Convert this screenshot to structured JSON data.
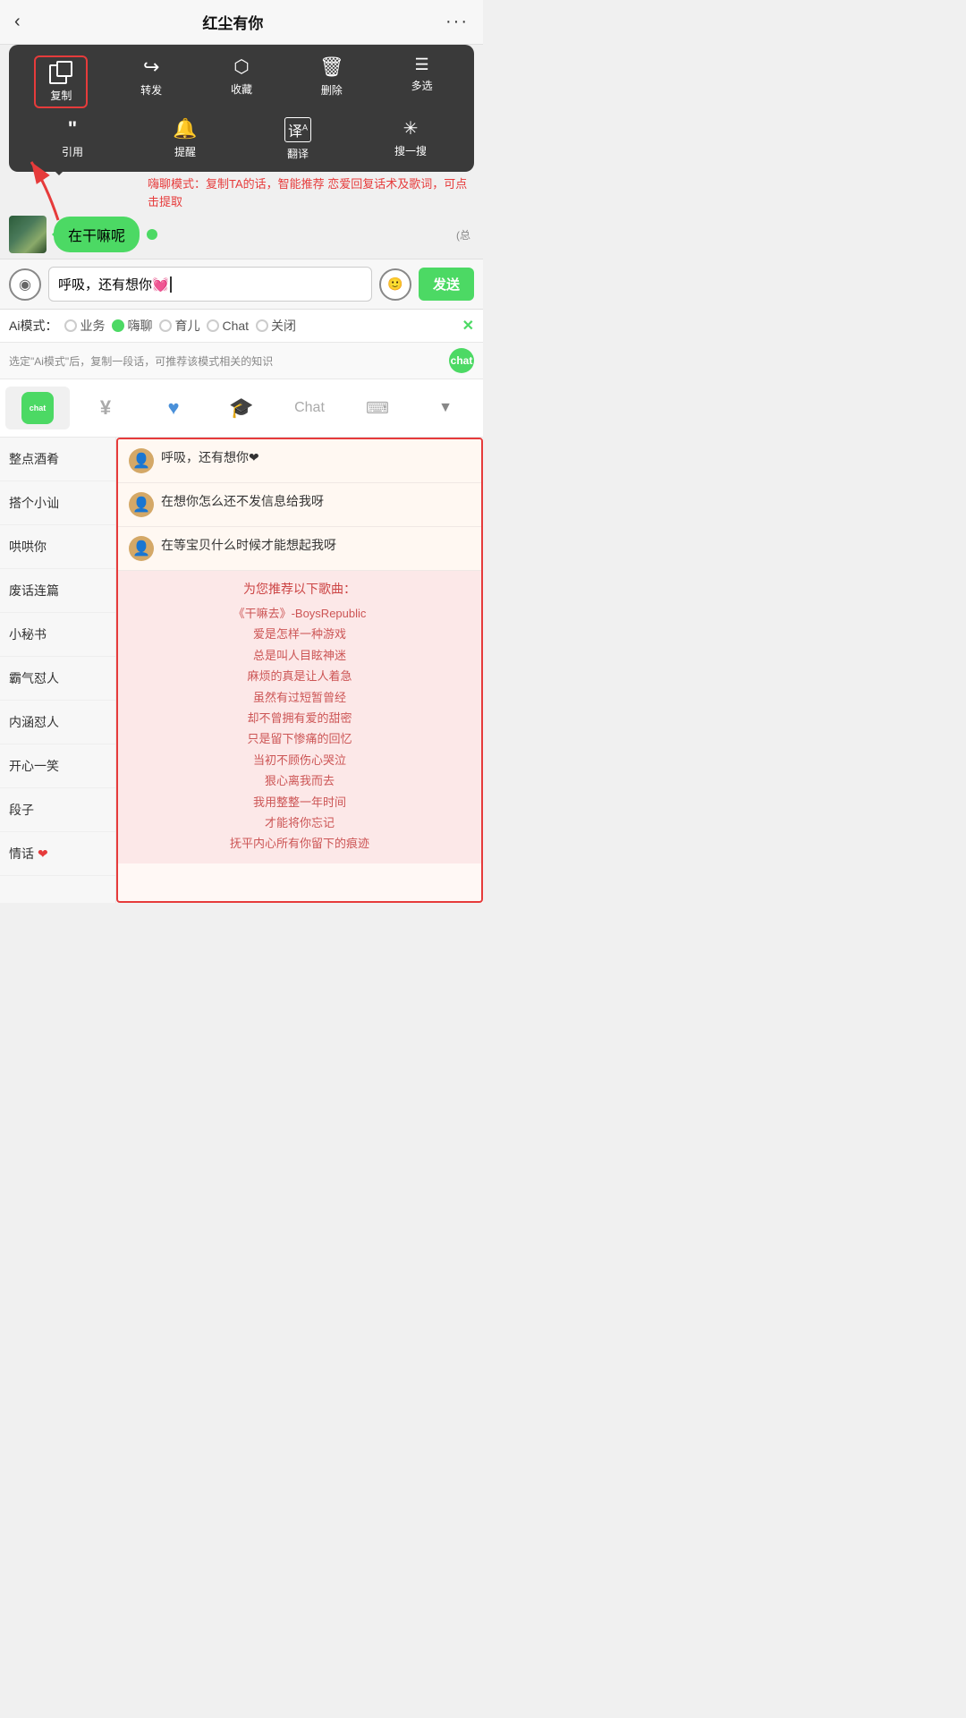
{
  "header": {
    "title": "红尘有你",
    "back_label": "‹",
    "more_label": "···"
  },
  "context_menu": {
    "row1": [
      {
        "id": "copy",
        "icon": "copy",
        "label": "复制",
        "selected": true
      },
      {
        "id": "forward",
        "icon": "↪",
        "label": "转发",
        "selected": false
      },
      {
        "id": "collect",
        "icon": "🎁",
        "label": "收藏",
        "selected": false
      },
      {
        "id": "delete",
        "icon": "🗑",
        "label": "删除",
        "selected": false
      },
      {
        "id": "multiselect",
        "icon": "☰",
        "label": "多选",
        "selected": false
      }
    ],
    "row2": [
      {
        "id": "quote",
        "icon": "❝",
        "label": "引用",
        "selected": false
      },
      {
        "id": "remind",
        "icon": "🔔",
        "label": "提醒",
        "selected": false
      },
      {
        "id": "translate",
        "icon": "译",
        "label": "翻译",
        "selected": false
      },
      {
        "id": "search",
        "icon": "✳",
        "label": "搜一搜",
        "selected": false
      }
    ]
  },
  "annotation": {
    "text": "嗨聊模式：复制TA的话，智能推荐\n恋爱回复话术及歌词，可点击提取"
  },
  "chat_bubble": {
    "message": "在干嘛呢"
  },
  "input": {
    "value": "呼吸，还有想你💓",
    "send_label": "发送"
  },
  "ai_modes": {
    "label": "Ai模式：",
    "options": [
      {
        "id": "business",
        "label": "业务",
        "selected": false
      },
      {
        "id": "haichat",
        "label": "嗨聊",
        "selected": true
      },
      {
        "id": "parenting",
        "label": "育儿",
        "selected": false
      },
      {
        "id": "chat",
        "label": "Chat",
        "selected": false
      },
      {
        "id": "close",
        "label": "关闭",
        "selected": false
      }
    ],
    "close_icon": "✕"
  },
  "hint_bar": {
    "text": "选定\"Ai模式\"后，复制一段话，可推荐该模式相关的知识"
  },
  "toolbar": {
    "items": [
      {
        "id": "chat-ai",
        "icon": "chat",
        "label": ""
      },
      {
        "id": "money",
        "icon": "¥",
        "label": ""
      },
      {
        "id": "heart",
        "icon": "♥",
        "label": ""
      },
      {
        "id": "grad",
        "icon": "🎓",
        "label": ""
      },
      {
        "id": "chat-text",
        "icon": "Chat",
        "label": ""
      },
      {
        "id": "keyboard",
        "icon": "⌨",
        "label": ""
      },
      {
        "id": "expand",
        "icon": "▼",
        "label": ""
      }
    ]
  },
  "sidebar": {
    "items": [
      {
        "id": "zhengdian",
        "label": "整点酒肴"
      },
      {
        "id": "dage",
        "label": "搭个小讪"
      },
      {
        "id": "hahaha",
        "label": "哄哄你"
      },
      {
        "id": "fehua",
        "label": "废话连篇"
      },
      {
        "id": "xiaomishu",
        "label": "小秘书"
      },
      {
        "id": "baqiren",
        "label": "霸气怼人"
      },
      {
        "id": "neihanyiren",
        "label": "内涵怼人"
      },
      {
        "id": "kaixin",
        "label": "开心一笑"
      },
      {
        "id": "duanzi",
        "label": "段子"
      },
      {
        "id": "qinghua",
        "label": "情话",
        "heart": true
      }
    ]
  },
  "suggestions": [
    {
      "text": "呼吸，还有想你❤"
    },
    {
      "text": "在想你怎么还不发信息给我呀"
    },
    {
      "text": "在等宝贝什么时候才能想起我呀"
    }
  ],
  "song_section": {
    "title": "为您推荐以下歌曲：",
    "song_name": "《干嘛去》-BoysRepublic",
    "lyrics": [
      "爱是怎样一种游戏",
      "总是叫人目眩神迷",
      "麻烦的真是让人着急",
      "虽然有过短暂曾经",
      "却不曾拥有爱的甜密",
      "只是留下惨痛的回忆",
      "当初不顾伤心哭泣",
      "狠心离我而去",
      "我用整整一年时间",
      "才能将你忘记",
      "抚平内心所有你留下的痕迹"
    ]
  }
}
